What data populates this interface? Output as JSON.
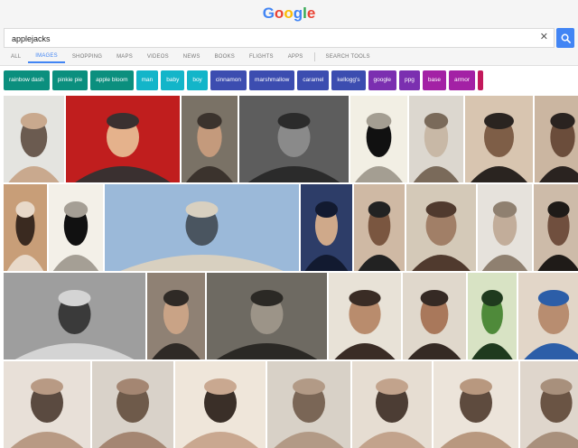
{
  "logo": {
    "letters": [
      {
        "ch": "G",
        "color": "#4285f4"
      },
      {
        "ch": "o",
        "color": "#ea4335"
      },
      {
        "ch": "o",
        "color": "#fbbc05"
      },
      {
        "ch": "g",
        "color": "#4285f4"
      },
      {
        "ch": "l",
        "color": "#34a853"
      },
      {
        "ch": "e",
        "color": "#ea4335"
      }
    ]
  },
  "search": {
    "value": "applejacks",
    "clear_icon": "close-icon",
    "button_icon": "search-icon"
  },
  "tabs": [
    {
      "label": "ALL",
      "active": false
    },
    {
      "label": "IMAGES",
      "active": true
    },
    {
      "label": "SHOPPING",
      "active": false
    },
    {
      "label": "MAPS",
      "active": false
    },
    {
      "label": "VIDEOS",
      "active": false
    },
    {
      "label": "NEWS",
      "active": false
    },
    {
      "label": "BOOKS",
      "active": false
    },
    {
      "label": "FLIGHTS",
      "active": false
    },
    {
      "label": "APPS",
      "active": false
    },
    {
      "label": "SEARCH TOOLS",
      "active": false
    }
  ],
  "chips": [
    {
      "label": "rainbow dash",
      "color": "#0b8f7e"
    },
    {
      "label": "pinkie pie",
      "color": "#0b8f7e"
    },
    {
      "label": "apple bloom",
      "color": "#0b8f7e"
    },
    {
      "label": "man",
      "color": "#13b5c9"
    },
    {
      "label": "baby",
      "color": "#13b5c9"
    },
    {
      "label": "boy",
      "color": "#13b5c9"
    },
    {
      "label": "cinnamon",
      "color": "#3c4db0"
    },
    {
      "label": "marshmallow",
      "color": "#3c4db0"
    },
    {
      "label": "caramel",
      "color": "#3c4db0"
    },
    {
      "label": "kellogg's",
      "color": "#3c4db0"
    },
    {
      "label": "google",
      "color": "#7b2fb0"
    },
    {
      "label": "ppg",
      "color": "#7b2fb0"
    },
    {
      "label": "base",
      "color": "#a321a5"
    },
    {
      "label": "armor",
      "color": "#a321a5"
    },
    {
      "label": "",
      "color": "#c2185b"
    }
  ],
  "colors": {
    "accent": "#4285f4",
    "header_bg": "#f5f5f5"
  },
  "results": {
    "rows": [
      [
        {
          "palette": [
            "#e4e4e0",
            "#6b5b50",
            "#c9a98e"
          ]
        },
        {
          "palette": [
            "#c01e1e",
            "#e5b28c",
            "#3a3030"
          ]
        },
        {
          "palette": [
            "#7a7266",
            "#c49a7c",
            "#3b332d"
          ]
        },
        {
          "palette": [
            "#5d5d5d",
            "#8a8a8a",
            "#2b2b2b"
          ]
        },
        {
          "palette": [
            "#f2efe4",
            "#111111",
            "#a49e92"
          ]
        },
        {
          "palette": [
            "#dcd7cf",
            "#c8b8a6",
            "#7a6a5a"
          ]
        },
        {
          "palette": [
            "#d8c5b0",
            "#7e5e47",
            "#2a2420"
          ]
        },
        {
          "palette": [
            "#cbb6a1",
            "#6b4d3b",
            "#2a2320"
          ]
        }
      ],
      [
        {
          "palette": [
            "#c89e78",
            "#3a2a20",
            "#e8d9c9"
          ]
        },
        {
          "palette": [
            "#f3f0e8",
            "#111111",
            "#a59f95"
          ]
        },
        {
          "palette": [
            "#9bb9d9",
            "#4a5560",
            "#d8d0c0"
          ]
        },
        {
          "palette": [
            "#2d3d68",
            "#cfa98a",
            "#121a30"
          ]
        },
        {
          "palette": [
            "#cfb9a4",
            "#7a5640",
            "#222222"
          ]
        },
        {
          "palette": [
            "#d4c9b8",
            "#a17f67",
            "#503a2e"
          ]
        },
        {
          "palette": [
            "#e6e2dc",
            "#c2ad9a",
            "#8f8070"
          ]
        },
        {
          "palette": [
            "#cdbba9",
            "#704f3e",
            "#1f1b18"
          ]
        }
      ],
      [
        {
          "palette": [
            "#9e9e9e",
            "#3a3a3a",
            "#d4d4d4"
          ]
        },
        {
          "palette": [
            "#8f8174",
            "#c9a386",
            "#2f2a26"
          ]
        },
        {
          "palette": [
            "#6e6a62",
            "#9c9488",
            "#2b2925"
          ]
        },
        {
          "palette": [
            "#e8e2d7",
            "#b98c6d",
            "#3a2c25"
          ]
        },
        {
          "palette": [
            "#e0d8cc",
            "#a9785b",
            "#352a24"
          ]
        },
        {
          "palette": [
            "#d8e3c4",
            "#4f8a3a",
            "#1f3a1e"
          ]
        },
        {
          "palette": [
            "#e2d6c8",
            "#b88d70",
            "#2c5ea8"
          ]
        }
      ],
      [
        {
          "palette": [
            "#e8e0d8",
            "#5a4a40",
            "#b89a84"
          ]
        },
        {
          "palette": [
            "#d9d2c9",
            "#6e5a4a",
            "#a48672"
          ]
        },
        {
          "palette": [
            "#efe6da",
            "#3a2f28",
            "#c9a890"
          ]
        },
        {
          "palette": [
            "#d8d1c7",
            "#7a6656",
            "#b29a86"
          ]
        },
        {
          "palette": [
            "#e6ddd2",
            "#4c3d34",
            "#c2a38c"
          ]
        },
        {
          "palette": [
            "#ece4da",
            "#5e4b3e",
            "#b8987f"
          ]
        },
        {
          "palette": [
            "#dfd6cc",
            "#6a5444",
            "#a8907c"
          ]
        }
      ]
    ]
  }
}
